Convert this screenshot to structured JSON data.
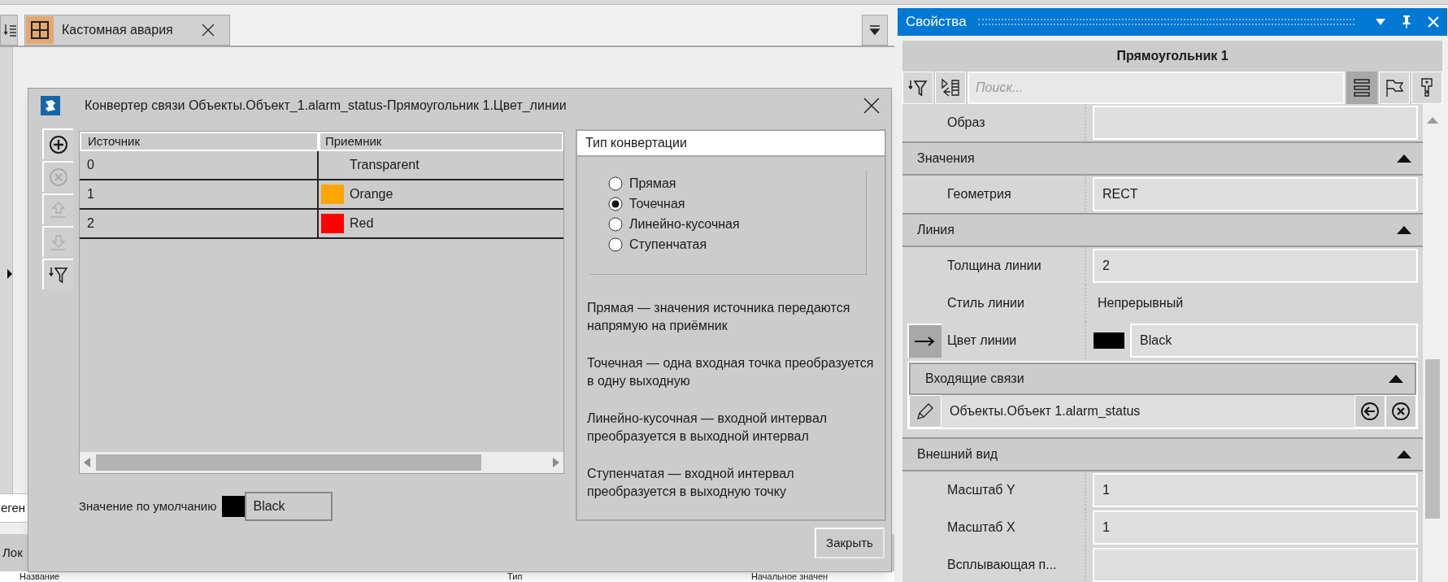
{
  "document_tabs": [
    {
      "label": "Кастомная авария",
      "selected": true
    }
  ],
  "bottom_panel": {
    "search_value": "еген",
    "tab": "Лок",
    "columns": [
      "Название",
      "Тип",
      "Начальное значен"
    ]
  },
  "dialog": {
    "title": "Конвертер связи Объекты.Объект_1.alarm_status-Прямоугольник 1.Цвет_линии",
    "toolbar": [
      {
        "kind": "add",
        "disabled": false
      },
      {
        "kind": "remove",
        "disabled": true
      },
      {
        "kind": "up",
        "disabled": true
      },
      {
        "kind": "down",
        "disabled": true
      },
      {
        "kind": "filter",
        "disabled": false
      }
    ],
    "table": {
      "columns": [
        "Источник",
        "Приемник"
      ],
      "rows": [
        {
          "source": "0",
          "target": "Transparent"
        },
        {
          "source": "1",
          "target": "Orange",
          "color": "#ffa500"
        },
        {
          "source": "2",
          "target": "Red",
          "color": "#ff0000"
        }
      ]
    },
    "default_value": {
      "label": "Значение по умолчанию",
      "color": "#000000",
      "value": "Black"
    },
    "conversion": {
      "title": "Тип конвертации",
      "options": [
        {
          "label": "Прямая",
          "selected": false
        },
        {
          "label": "Точечная",
          "selected": true
        },
        {
          "label": "Линейно-кусочная",
          "selected": false
        },
        {
          "label": "Ступенчатая",
          "selected": false
        }
      ],
      "descriptions": [
        "Прямая — значения источника передаются напрямую на приёмник",
        "Точечная — одна входная точка преобразуется в одну выходную",
        "Линейно-кусочная — входной интервал преобразуется в выходной интервал",
        "Ступенчатая — входной интервал преобразуется в выходную точку"
      ]
    },
    "close_button": "Закрыть"
  },
  "properties": {
    "title": "Свойства",
    "object": "Прямоугольник 1",
    "search_placeholder": "Поиск...",
    "rows": [
      {
        "kind": "field",
        "label": "Образ"
      },
      {
        "kind": "section",
        "label": "Значения",
        "expanded": true
      },
      {
        "kind": "field",
        "label": "Геометрия",
        "value": "RECT"
      },
      {
        "kind": "section",
        "label": "Линия",
        "expanded": true
      },
      {
        "kind": "field",
        "label": "Толщина линии",
        "value": "2"
      },
      {
        "kind": "plain",
        "label": "Стиль линии",
        "value": "Непрерывный"
      },
      {
        "kind": "color",
        "label": "Цвет линии",
        "color": "#000000",
        "value": "Black",
        "bound": true
      },
      {
        "kind": "links",
        "label": "Входящие связи",
        "expanded": true,
        "items": [
          "Объекты.Объект 1.alarm_status"
        ]
      },
      {
        "kind": "section",
        "label": "Внешний вид",
        "expanded": true
      },
      {
        "kind": "field",
        "label": "Масштаб Y",
        "value": "1"
      },
      {
        "kind": "field",
        "label": "Масштаб X",
        "value": "1"
      },
      {
        "kind": "field",
        "label": "Всплывающая п..."
      }
    ]
  }
}
